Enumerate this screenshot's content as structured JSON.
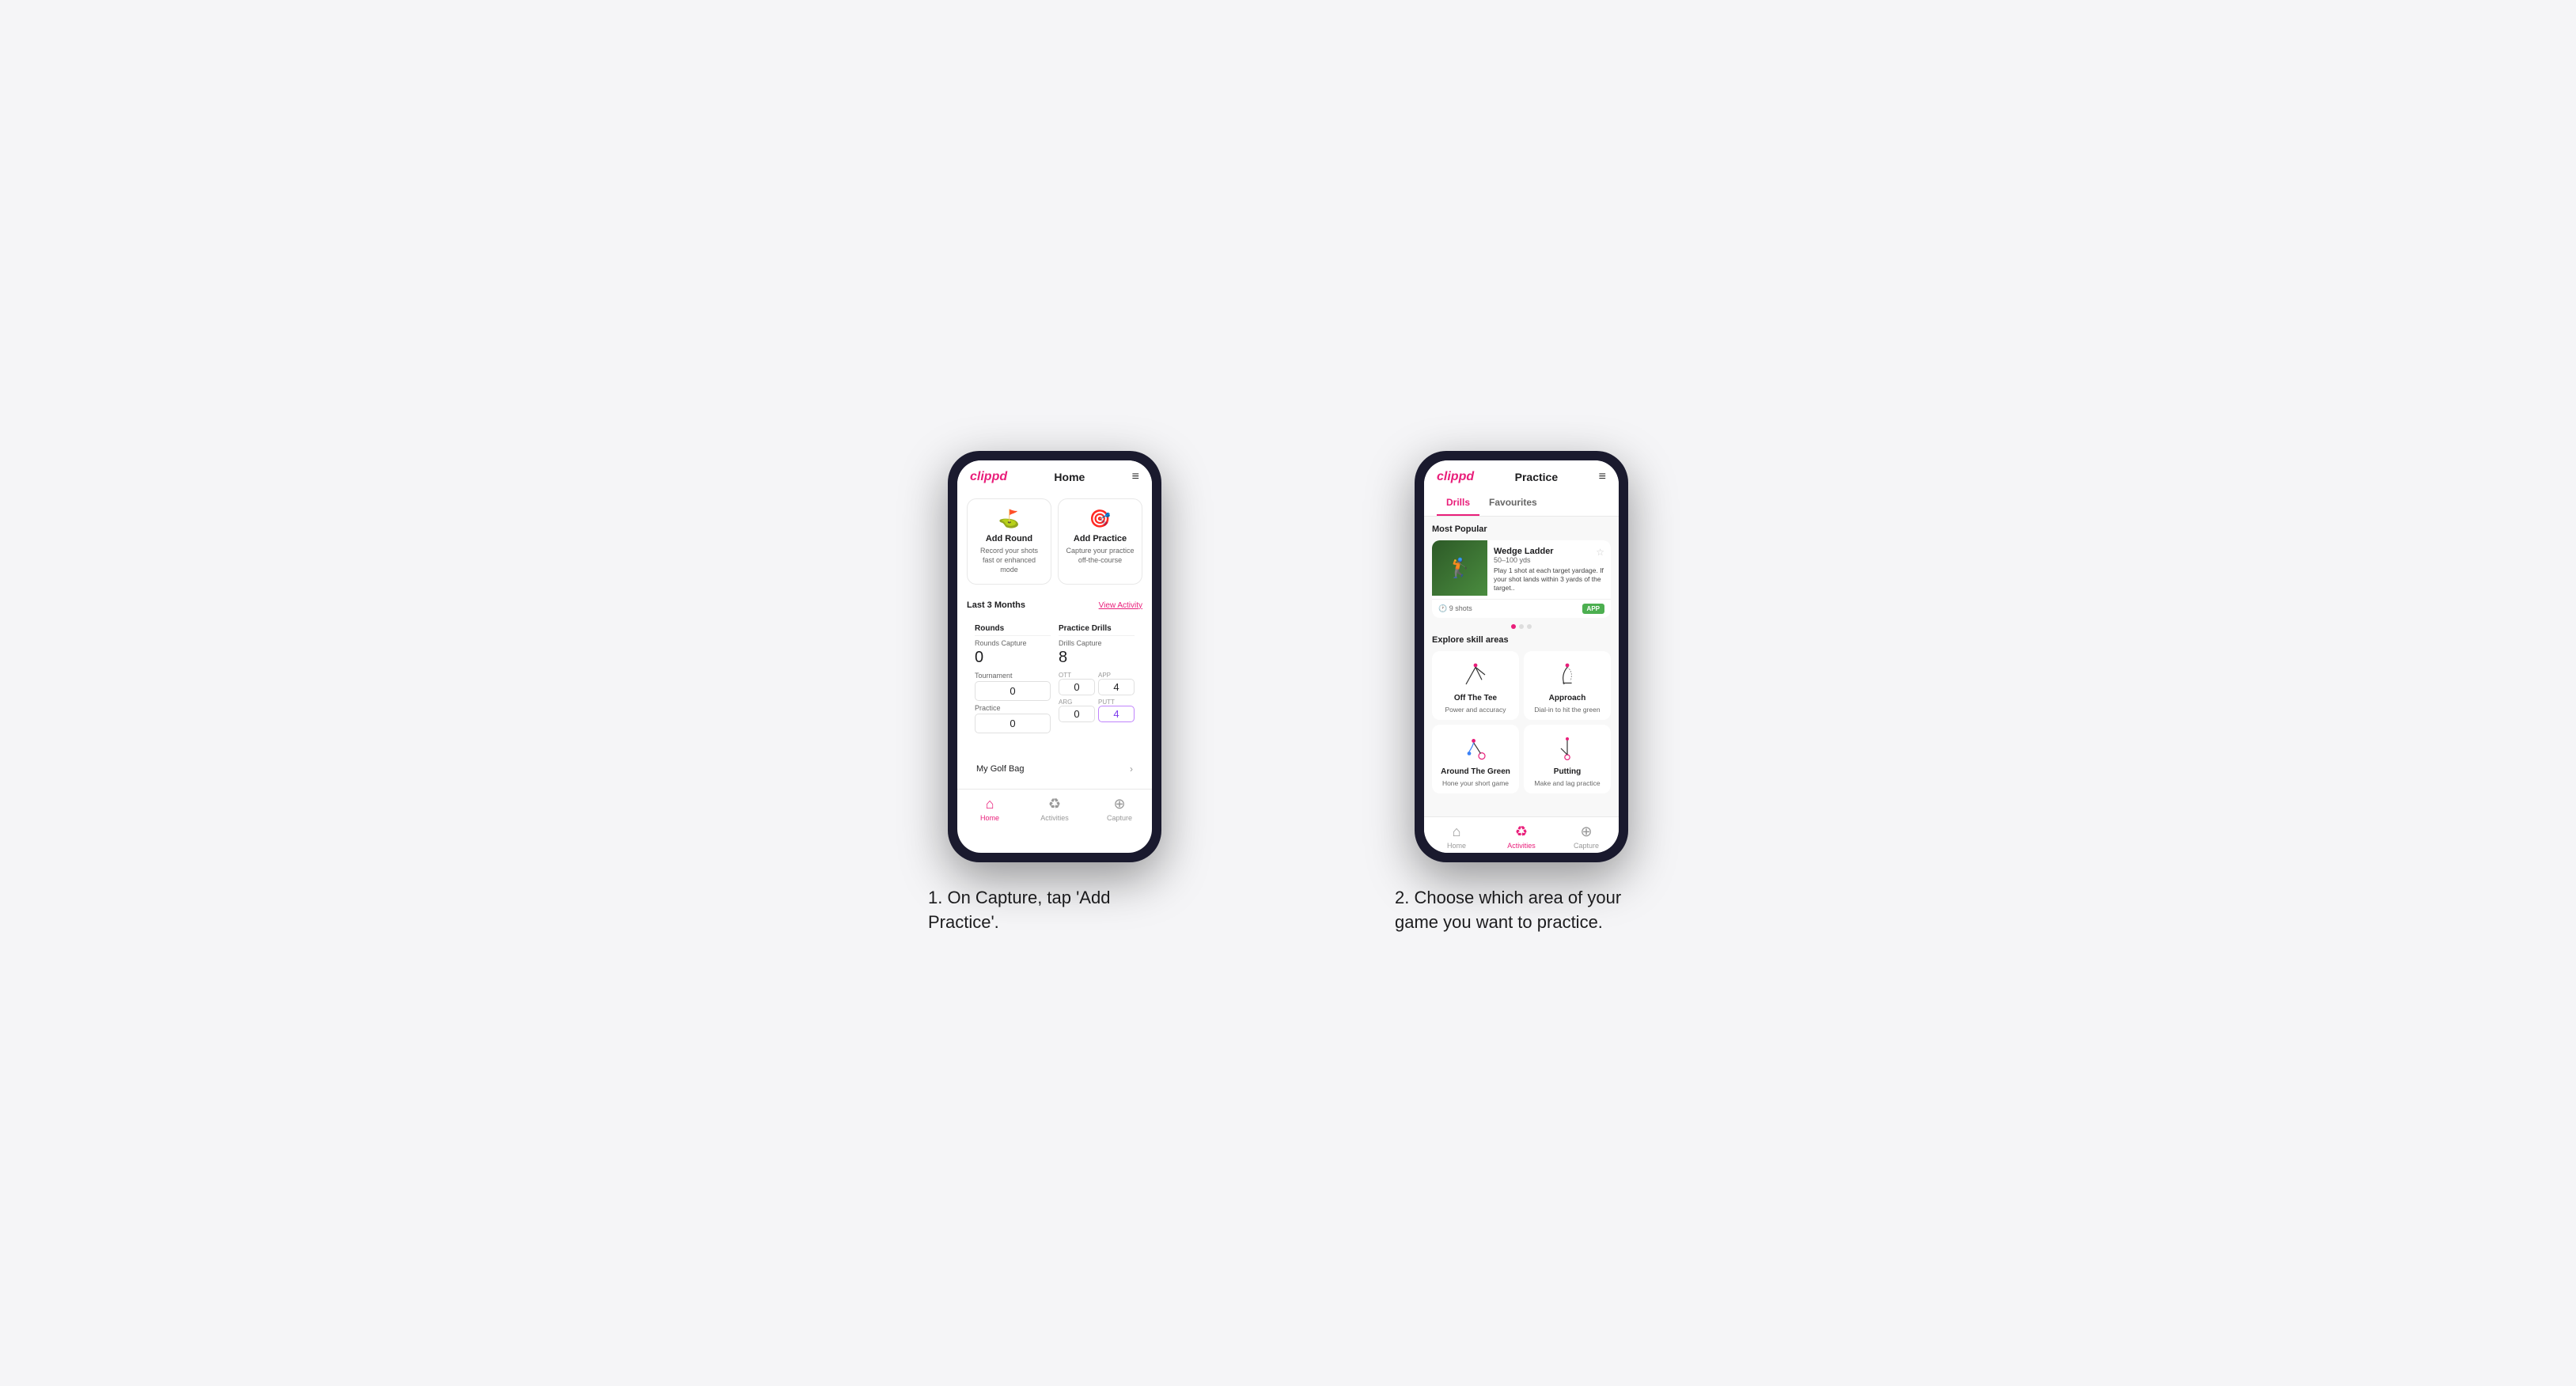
{
  "phone1": {
    "header": {
      "logo": "clippd",
      "title": "Home",
      "menu_icon": "≡"
    },
    "action_cards": [
      {
        "id": "add-round",
        "icon": "⛳",
        "title": "Add Round",
        "subtitle": "Record your shots fast or enhanced mode"
      },
      {
        "id": "add-practice",
        "icon": "🎯",
        "title": "Add Practice",
        "subtitle": "Capture your practice off-the-course"
      }
    ],
    "stats": {
      "period_label": "Last 3 Months",
      "view_activity": "View Activity",
      "rounds": {
        "title": "Rounds",
        "rounds_capture_label": "Rounds Capture",
        "rounds_capture_val": "0",
        "tournament_label": "Tournament",
        "tournament_val": "0",
        "practice_label": "Practice",
        "practice_val": "0"
      },
      "practice_drills": {
        "title": "Practice Drills",
        "drills_capture_label": "Drills Capture",
        "drills_capture_val": "8",
        "ott_label": "OTT",
        "ott_val": "0",
        "app_label": "APP",
        "app_val": "4",
        "arg_label": "ARG",
        "arg_val": "0",
        "putt_label": "PUTT",
        "putt_val": "4"
      }
    },
    "golf_bag": {
      "label": "My Golf Bag"
    },
    "bottom_nav": [
      {
        "id": "home",
        "icon": "⌂",
        "label": "Home",
        "active": true
      },
      {
        "id": "activities",
        "icon": "⊕",
        "label": "Activities",
        "active": false
      },
      {
        "id": "capture",
        "icon": "⊕",
        "label": "Capture",
        "active": false
      }
    ]
  },
  "phone2": {
    "header": {
      "logo": "clippd",
      "title": "Practice",
      "menu_icon": "≡"
    },
    "tabs": [
      {
        "id": "drills",
        "label": "Drills",
        "active": true
      },
      {
        "id": "favourites",
        "label": "Favourites",
        "active": false
      }
    ],
    "most_popular": {
      "section_label": "Most Popular",
      "drill": {
        "title": "Wedge Ladder",
        "range": "50–100 yds",
        "description": "Play 1 shot at each target yardage. If your shot lands within 3 yards of the target..",
        "shots_label": "9 shots",
        "badge": "APP"
      },
      "dots": [
        true,
        false,
        false
      ]
    },
    "skill_areas": {
      "section_label": "Explore skill areas",
      "items": [
        {
          "id": "off-the-tee",
          "name": "Off The Tee",
          "subtitle": "Power and accuracy",
          "icon_type": "arc"
        },
        {
          "id": "approach",
          "name": "Approach",
          "subtitle": "Dial-in to hit the green",
          "icon_type": "arc2"
        },
        {
          "id": "around-the-green",
          "name": "Around The Green",
          "subtitle": "Hone your short game",
          "icon_type": "chip"
        },
        {
          "id": "putting",
          "name": "Putting",
          "subtitle": "Make and lag practice",
          "icon_type": "putt"
        }
      ]
    },
    "bottom_nav": [
      {
        "id": "home",
        "icon": "⌂",
        "label": "Home",
        "active": false
      },
      {
        "id": "activities",
        "icon": "⊕",
        "label": "Activities",
        "active": true
      },
      {
        "id": "capture",
        "icon": "⊕",
        "label": "Capture",
        "active": false
      }
    ]
  },
  "captions": {
    "phone1": "1. On Capture, tap 'Add Practice'.",
    "phone2": "2. Choose which area of your game you want to practice."
  }
}
